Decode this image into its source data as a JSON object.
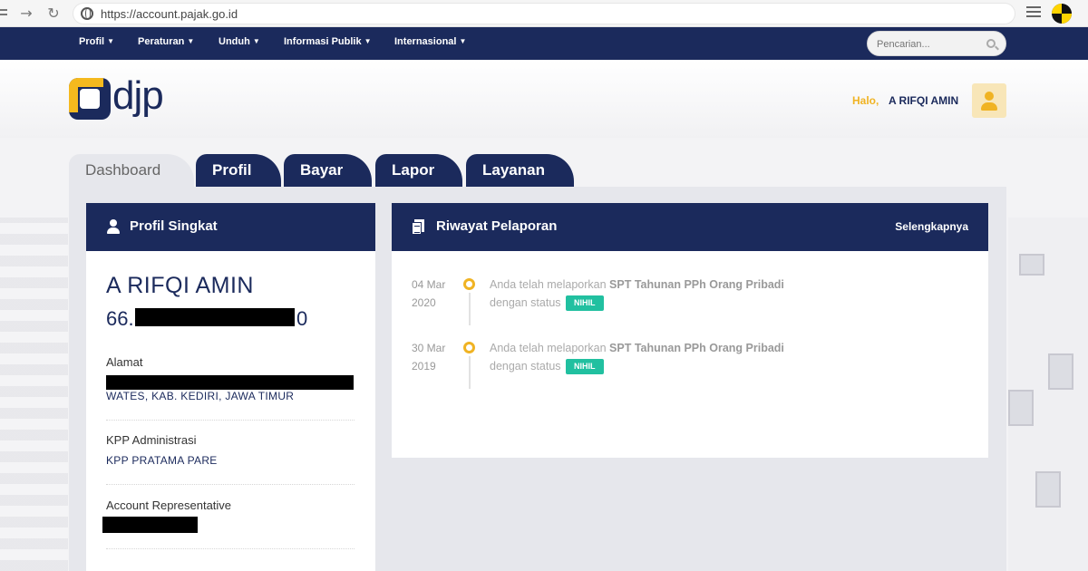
{
  "browser": {
    "url": "https://account.pajak.go.id"
  },
  "nav": {
    "menu": [
      "Profil",
      "Peraturan",
      "Unduh",
      "Informasi Publik",
      "Internasional"
    ],
    "search_placeholder": "Pencarian..."
  },
  "header": {
    "logo_text": "djp",
    "greeting": "Halo,",
    "user_name": "A RIFQI AMIN"
  },
  "tabs": [
    "Dashboard",
    "Profil",
    "Bayar",
    "Lapor",
    "Layanan"
  ],
  "profile_card": {
    "title": "Profil Singkat",
    "name": "A RIFQI AMIN",
    "npwp_prefix": "66.",
    "npwp_suffix": "0",
    "address_label": "Alamat",
    "address_value": "WATES, KAB. KEDIRI, JAWA TIMUR",
    "kpp_label": "KPP Administrasi",
    "kpp_value": "KPP PRATAMA PARE",
    "ar_label": "Account Representative"
  },
  "history_card": {
    "title": "Riwayat Pelaporan",
    "more_link": "Selengkapnya",
    "entries": [
      {
        "date_line1": "04 Mar",
        "date_line2": "2020",
        "text_prefix": "Anda telah melaporkan",
        "text_bold": "SPT Tahunan PPh Orang Pribadi",
        "text_status": "dengan status",
        "badge": "NIHIL"
      },
      {
        "date_line1": "30 Mar",
        "date_line2": "2019",
        "text_prefix": "Anda telah melaporkan",
        "text_bold": "SPT Tahunan PPh Orang Pribadi",
        "text_status": "dengan status",
        "badge": "NIHIL"
      }
    ]
  },
  "colors": {
    "navy": "#1b2a5c",
    "accent": "#f0b323",
    "badge": "#21c0a0"
  }
}
